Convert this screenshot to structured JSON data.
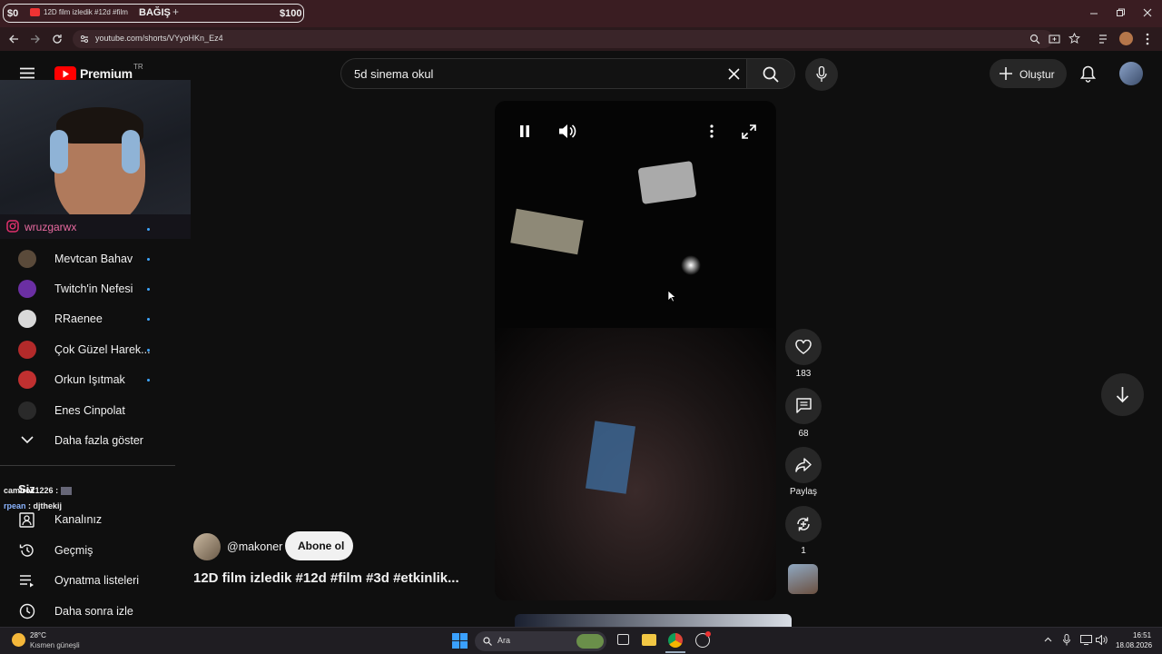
{
  "browser": {
    "donation_left": "$0",
    "tab_title": "12D film izledik #12d #film",
    "donation_label": "BAĞIŞ",
    "new_tab": "+",
    "donation_right": "$100",
    "url": "youtube.com/shorts/VYyoHKn_Ez4"
  },
  "header": {
    "logo_text": "Premium",
    "region": "TR",
    "search_value": "5d sinema okul",
    "create_label": "Oluştur"
  },
  "streamer": {
    "instagram_handle": "wruzgarwx"
  },
  "sidebar": {
    "subscriptions": [
      {
        "label": "Mevtcan Bahav",
        "color": "#5a4a3a"
      },
      {
        "label": "Twitch'in Nefesi",
        "color": "#6b2fa3"
      },
      {
        "label": "RRaenee",
        "color": "#d9d9d9"
      },
      {
        "label": "Çok Güzel Harek...",
        "color": "#b32a2a"
      },
      {
        "label": "Orkun Işıtmak",
        "color": "#c03030"
      },
      {
        "label": "Enes Cinpolat",
        "color": "#2a2a2a"
      }
    ],
    "show_more": "Daha fazla göster",
    "section_you": "Siz",
    "you_items": [
      {
        "label": "Kanalınız",
        "icon": "channel-icon"
      },
      {
        "label": "Geçmiş",
        "icon": "history-icon"
      },
      {
        "label": "Oynatma listeleri",
        "icon": "playlist-icon"
      },
      {
        "label": "Daha sonra izle",
        "icon": "watch-later-icon"
      }
    ]
  },
  "chat": [
    {
      "user": "camirox1226",
      "message": ":",
      "color": "#f1f1f1"
    },
    {
      "user": "rpean",
      "message": ": djthekij",
      "color": "#8ab4ff"
    }
  ],
  "short": {
    "channel": "@makoner",
    "subscribe_label": "Abone ol",
    "title": "12D film izledik #12d #film #3d #etkinlik...",
    "likes": "183",
    "comments": "68",
    "share_label": "Paylaş",
    "remix_count": "1"
  },
  "taskbar": {
    "temperature": "28°C",
    "weather": "Kısmen güneşli",
    "search_placeholder": "Ara",
    "time": "16:51",
    "date": "18.08.2026"
  }
}
